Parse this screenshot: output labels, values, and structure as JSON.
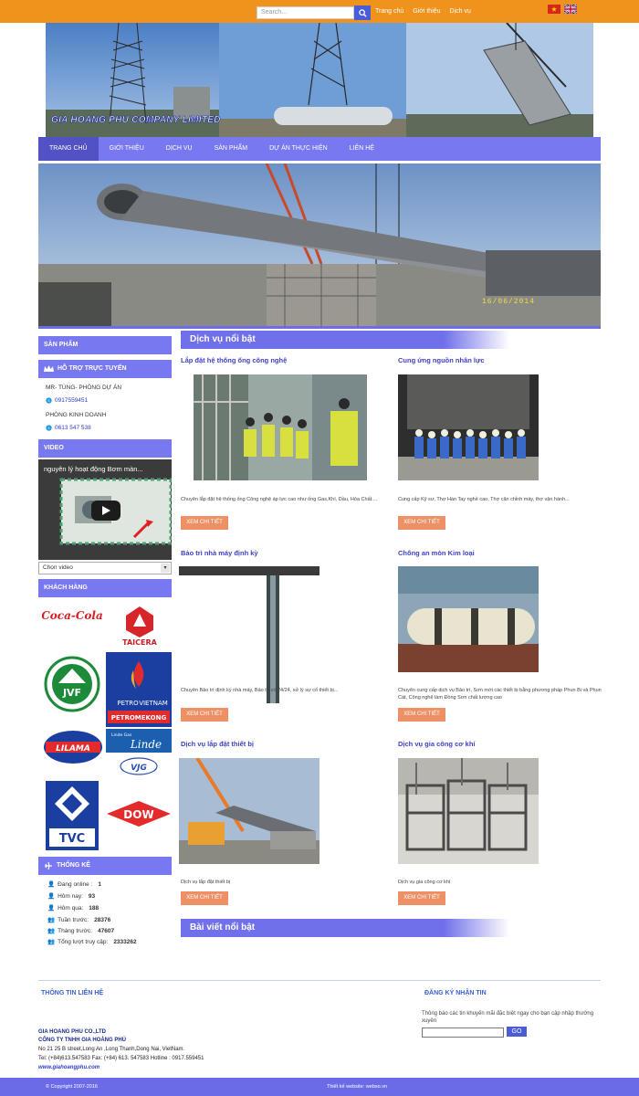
{
  "topbar": {
    "search_placeholder": "Search...",
    "links": [
      "Trang chủ",
      "Giới thiệu",
      "Dịch vụ"
    ]
  },
  "header": {
    "company_name": "GIA HOANG PHU COMPANY LIMITED"
  },
  "nav": {
    "items": [
      "TRANG CHỦ",
      "GIỚI THIỆU",
      "DỊCH VỤ",
      "SẢN PHẨM",
      "DỰ ÁN THỰC HIỆN",
      "LIÊN HỆ"
    ]
  },
  "slider": {
    "date_stamp": "16/06/2014"
  },
  "sidebar": {
    "products_title": "SẢN PHẨM",
    "support_title": "HỖ TRỢ TRỰC TUYẾN",
    "contact1_name": "MR- TÙNG- PHÒNG DỰ ÁN",
    "contact1_phone": "0917559451",
    "contact2_name": "PHÒNG KINH DOANH",
    "contact2_phone": "0613 547 538",
    "video_title": "VIDEO",
    "video_caption": "nguyên lý hoạt động Bơm màn...",
    "select_value": "Chọn video",
    "customers_title": "KHÁCH HÀNG",
    "customer_logos": {
      "coca": "Coca-Cola",
      "taicera": "TAICERA",
      "jvf": "JVF",
      "petro1": "PETRO",
      "petro2": "VIETNAM",
      "petro3": "PETROMEKONG",
      "lilama": "LILAMA",
      "linde_small": "Linde Gas",
      "linde": "Linde",
      "vjg": "VJG",
      "tvc": "TVC",
      "dow": "DOW"
    },
    "stats_title": "THỐNG KÊ",
    "stats": {
      "online_label": "Đang online :",
      "online_value": "1",
      "today_label": "Hôm nay:",
      "today_value": "93",
      "yesterday_label": "Hôm qua:",
      "yesterday_value": "188",
      "lastweek_label": "Tuần trước:",
      "lastweek_value": "28376",
      "lastmonth_label": "Tháng trước:",
      "lastmonth_value": "47607",
      "total_label": "Tổng lượt truy cập:",
      "total_value": "2333262"
    }
  },
  "main": {
    "featured_services_title": "Dịch vụ nổi bật",
    "featured_posts_title": "Bài viết nổi bật",
    "button_label": "XEM CHI TIẾT",
    "services": [
      {
        "title": "Lắp đặt hệ thống ống công nghệ",
        "desc": "Chuyên lắp đặt hệ thống ống Công nghệ áp lực cao như ống Gas,Khí, Dầu, Hóa Chất...."
      },
      {
        "title": "Cung ứng nguồn nhân lực",
        "desc": "Cung cấp Kỹ sư, Thợ Hàn Tay nghề cao, Thợ cân chỉnh máy, thợ vận hành..."
      },
      {
        "title": "Bảo trì nhà máy định kỳ",
        "desc": "Chuyên Bảo trì định kỳ nhà máy, Bảo trì có 24/24, xử lý sự cố thiết bị..."
      },
      {
        "title": "Chống an mòn Kim loại",
        "desc": "Chuyên cung cấp dịch vụ Bảo trì, Sơn mới các thiết bị bằng phương pháp Phun Bi và Phun Cát, Công nghệ làm Đồng Sơn chất lượng cao"
      },
      {
        "title": "Dịch vụ lắp đặt thiết bị",
        "desc": "Dịch vụ lắp đặt thiết bị"
      },
      {
        "title": "Dịch vụ gia công cơ khí",
        "desc": "Dịch vụ gia công cơ khí"
      }
    ]
  },
  "footer": {
    "contact_title": "THÔNG TIN LIÊN HỆ",
    "newsletter_title": "ĐĂNG KÝ NHẬN TIN",
    "newsletter_desc": "Thông báo các tin khuyến mãi đặc biệt ngay cho bạn cập nhập thường xuyên",
    "go_label": "GO",
    "company_en": "GIA HOANG PHU CO.,LTD",
    "company_vn": "CÔNG TY TNHH GIA HOÀNG PHÚ",
    "address": "No 21  25 B street,Long An ,Long Thanh,Dong Nai, VietNam.",
    "phones": "Tel: (+84)613.547583  Fax: (+84) 613. 547583  Hotline : 0917.559451",
    "website": "www.giahoangphu.com",
    "copyright": "© Copyright 2007-2016",
    "designer": "Thiết kế website: webso.vn"
  }
}
